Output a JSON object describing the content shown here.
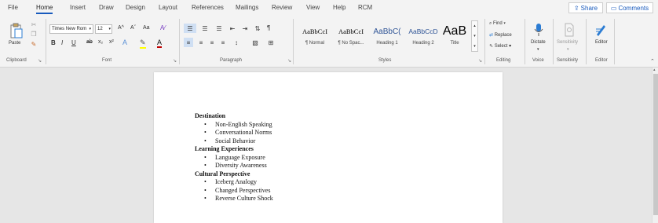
{
  "tabs": [
    "File",
    "Home",
    "Insert",
    "Draw",
    "Design",
    "Layout",
    "References",
    "Mailings",
    "Review",
    "View",
    "Help",
    "RCM"
  ],
  "active_tab": "Home",
  "share_label": "Share",
  "comments_label": "Comments",
  "clipboard": {
    "paste_label": "Paste",
    "group_label": "Clipboard"
  },
  "font": {
    "name": "Times New Rom",
    "size": "12",
    "group_label": "Font",
    "grow": "A^",
    "shrink": "Aˇ",
    "case": "Aa",
    "bold": "B",
    "italic": "I",
    "underline": "U",
    "strike": "ab",
    "sub": "x₂",
    "sup": "x²"
  },
  "paragraph": {
    "group_label": "Paragraph",
    "pilcrow": "¶"
  },
  "styles": {
    "group_label": "Styles",
    "items": [
      {
        "sample": "AaBbCcI",
        "name": "¶ Normal",
        "color": "#111111"
      },
      {
        "sample": "AaBbCcI",
        "name": "¶ No Spac...",
        "color": "#111111"
      },
      {
        "sample": "AaBbC(",
        "name": "Heading 1",
        "color": "#2f5496"
      },
      {
        "sample": "AaBbCcD",
        "name": "Heading 2",
        "color": "#2f5496"
      },
      {
        "sample": "AaB",
        "name": "Title",
        "color": "#111111"
      }
    ]
  },
  "editing": {
    "find": "Find",
    "replace": "Replace",
    "select": "Select",
    "group_label": "Editing"
  },
  "voice": {
    "dictate": "Dictate",
    "group_label": "Voice"
  },
  "sensitivity": {
    "label": "Sensitivity",
    "group_label": "Sensitivity"
  },
  "editor": {
    "label": "Editor",
    "group_label": "Editor"
  },
  "document": {
    "sections": [
      {
        "heading": "Destination",
        "items": [
          "Non-English Speaking",
          "Conversational Norms",
          "Social Behavior"
        ]
      },
      {
        "heading": "Learning Experiences",
        "items": [
          "Language Exposure",
          "Diversity Awareness"
        ]
      },
      {
        "heading": "Cultural Perspective",
        "items": [
          "Iceberg Analogy",
          "Changed Perspectives",
          "Reverse Culture Shock"
        ]
      }
    ]
  },
  "colors": {
    "accent": "#185abd",
    "highlight": "#ffff00",
    "font_color": "#c00000"
  }
}
